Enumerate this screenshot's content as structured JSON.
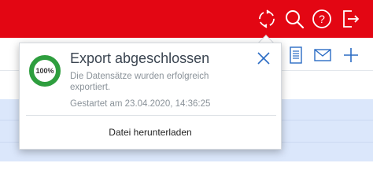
{
  "colors": {
    "brand_red": "#e30613",
    "accent_blue": "#2b6cc4",
    "progress_green": "#2e9e3e",
    "selection_blue": "#dbe7fb"
  },
  "topbar": {
    "icons": [
      "sync-icon",
      "search-icon",
      "help-icon",
      "logout-icon"
    ]
  },
  "toolbar": {
    "icons": [
      "document-icon",
      "mail-icon",
      "plus-icon"
    ]
  },
  "notification": {
    "progress_percent": 100,
    "progress_label": "100%",
    "title": "Export abgeschlossen",
    "description": "Die Datensätze wurden erfolgreich exportiert.",
    "started": "Gestartet am 23.04.2020, 14:36:25",
    "download_label": "Datei herunterladen"
  }
}
